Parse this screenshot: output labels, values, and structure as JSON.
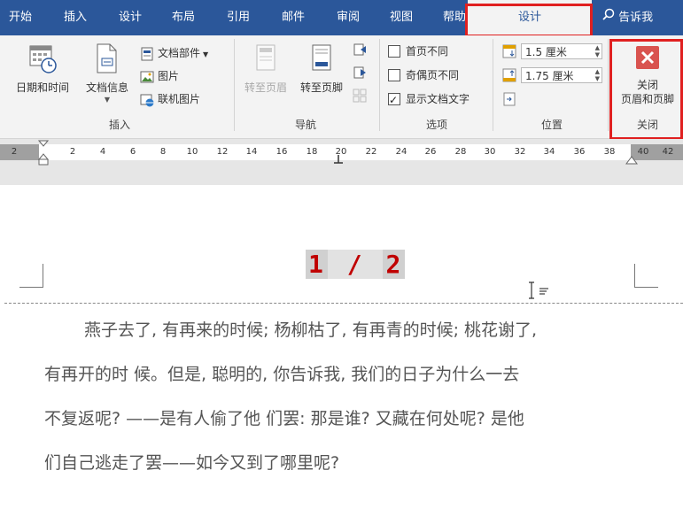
{
  "tabs": [
    {
      "label": "开始"
    },
    {
      "label": "插入"
    },
    {
      "label": "设计"
    },
    {
      "label": "布局"
    },
    {
      "label": "引用"
    },
    {
      "label": "邮件"
    },
    {
      "label": "审阅"
    },
    {
      "label": "视图"
    },
    {
      "label": "帮助"
    },
    {
      "label": "设计",
      "active": true
    }
  ],
  "tell_me": "告诉我",
  "ribbon": {
    "insert_group": {
      "label": "插入",
      "date_time": "日期和时间",
      "doc_info": "文档信息",
      "doc_parts": "文档部件",
      "pictures": "图片",
      "online_pictures": "联机图片"
    },
    "nav_group": {
      "label": "导航",
      "go_header": "转至页眉",
      "go_footer": "转至页脚"
    },
    "options_group": {
      "label": "选项",
      "different_first": "首页不同",
      "different_odd_even": "奇偶页不同",
      "show_doc_text": "显示文档文字"
    },
    "position_group": {
      "label": "位置",
      "header_distance": "1.5 厘米",
      "footer_distance": "1.75 厘米"
    },
    "close_group": {
      "label": "关闭",
      "close_line1": "关闭",
      "close_line2": "页眉和页脚"
    }
  },
  "ruler": {
    "labels": [
      "2",
      "2",
      "4",
      "6",
      "8",
      "10",
      "12",
      "14",
      "16",
      "18",
      "20",
      "22",
      "24",
      "26",
      "28",
      "30",
      "32",
      "34",
      "36",
      "38",
      "40",
      "42"
    ]
  },
  "page": {
    "page_num_current": "1",
    "page_num_sep": "/",
    "page_num_total": "2",
    "lines": [
      "燕子去了, 有再来的时候; 杨柳枯了, 有再青的时候; 桃花谢了,",
      "有再开的时 候。但是, 聪明的, 你告诉我, 我们的日子为什么一去",
      "不复返呢? ——是有人偷了他 们罢: 那是谁? 又藏在何处呢? 是他",
      "们自己逃走了罢——如今又到了哪里呢?"
    ]
  }
}
